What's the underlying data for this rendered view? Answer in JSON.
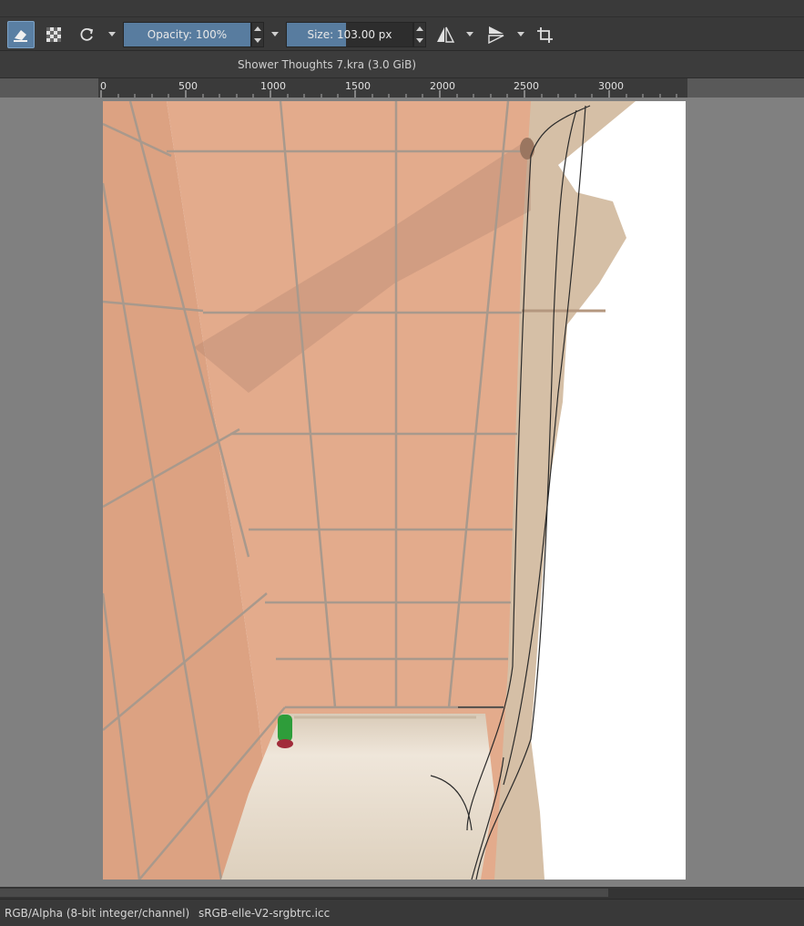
{
  "toolbar": {
    "opacity_label": "Opacity: 100%",
    "opacity_value": 1.0,
    "size_label": "Size: 103.00 px",
    "size_value": 103,
    "eraser_icon": "eraser-icon",
    "alpha_icon": "preserve-alpha-icon",
    "reload_icon": "reload-preset-icon",
    "mirror_h_icon": "mirror-horizontal-icon",
    "mirror_v_icon": "mirror-vertical-icon",
    "wrap_icon": "wrap-around-icon"
  },
  "document": {
    "title": "Shower Thoughts 7.kra (3.0 GiB)"
  },
  "ruler": {
    "ticks": [
      "0",
      "500",
      "1000",
      "1500",
      "2000",
      "2500",
      "3000"
    ]
  },
  "status": {
    "color_model": "RGB/Alpha (8-bit integer/channel)",
    "profile": "sRGB-elle-V2-srgbtrc.icc"
  },
  "colors": {
    "accent": "#587c9f",
    "tile": "#e2a888",
    "grout": "#a8988a",
    "tub": "#e6dccd"
  }
}
